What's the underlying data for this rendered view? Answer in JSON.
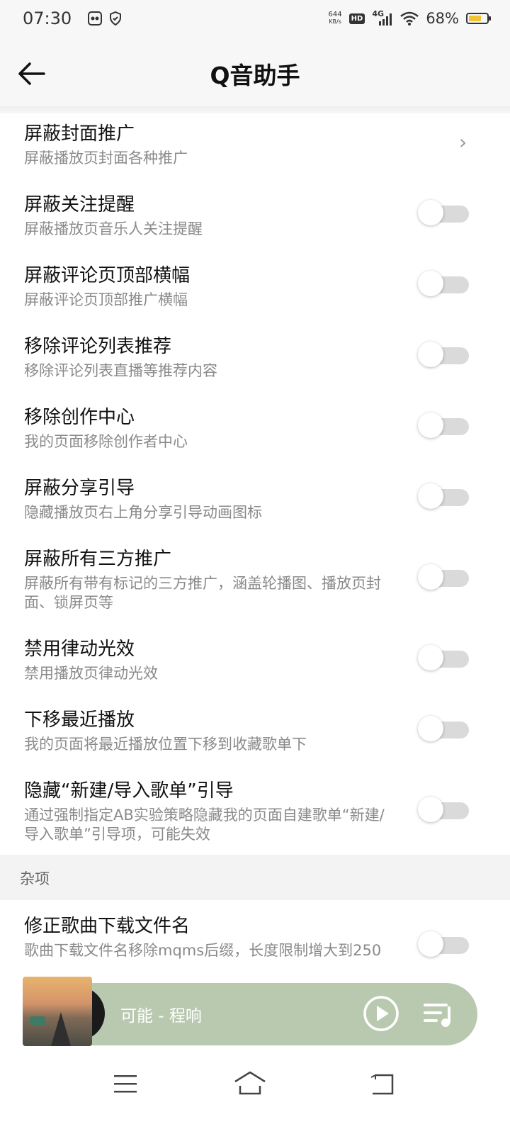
{
  "status_bar": {
    "time": "07:30",
    "net_speed_value": "644",
    "net_speed_unit": "KB/s",
    "hd": "HD",
    "network": "4G",
    "battery_percent": "68%",
    "battery_level": 0.68
  },
  "header": {
    "title": "Q音助手"
  },
  "settings": [
    {
      "title": "屏蔽封面推广",
      "subtitle": "屏蔽播放页封面各种推广",
      "control": "chevron"
    },
    {
      "title": "屏蔽关注提醒",
      "subtitle": "屏蔽播放页音乐人关注提醒",
      "control": "switch",
      "on": false
    },
    {
      "title": "屏蔽评论页顶部横幅",
      "subtitle": "屏蔽评论页顶部推广横幅",
      "control": "switch",
      "on": false
    },
    {
      "title": "移除评论列表推荐",
      "subtitle": "移除评论列表直播等推荐内容",
      "control": "switch",
      "on": false
    },
    {
      "title": "移除创作中心",
      "subtitle": "我的页面移除创作者中心",
      "control": "switch",
      "on": false
    },
    {
      "title": "屏蔽分享引导",
      "subtitle": "隐藏播放页右上角分享引导动画图标",
      "control": "switch",
      "on": false
    },
    {
      "title": "屏蔽所有三方推广",
      "subtitle": "屏蔽所有带有标记的三方推广，涵盖轮播图、播放页封面、锁屏页等",
      "control": "switch",
      "on": false
    },
    {
      "title": "禁用律动光效",
      "subtitle": "禁用播放页律动光效",
      "control": "switch",
      "on": false
    },
    {
      "title": "下移最近播放",
      "subtitle": "我的页面将最近播放位置下移到收藏歌单下",
      "control": "switch",
      "on": false
    },
    {
      "title": "隐藏“新建/导入歌单”引导",
      "subtitle": "通过强制指定AB实验策略隐藏我的页面自建歌单“新建/导入歌单”引导项，可能失效",
      "control": "switch",
      "on": false
    }
  ],
  "misc_section": {
    "header": "杂项",
    "items": [
      {
        "title": "修正歌曲下载文件名",
        "subtitle": "歌曲下载文件名移除mqms后缀，长度限制增大到250",
        "control": "switch",
        "on": false
      }
    ]
  },
  "player": {
    "song": "可能 - 程响"
  },
  "icons": {
    "back": "arrow-left-icon",
    "chevron": "chevron-right-icon",
    "play": "play-circle-icon",
    "queue": "playlist-icon",
    "nav_menu": "menu-icon",
    "nav_home": "home-icon",
    "nav_back": "back-icon"
  },
  "colors": {
    "player_bg": "#b9c9b0",
    "switch_off": "#dadada",
    "battery_fill": "#f1c232"
  }
}
